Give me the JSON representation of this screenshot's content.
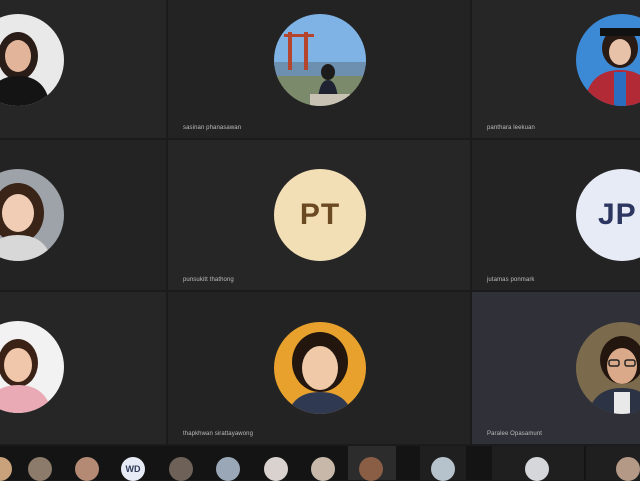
{
  "participants": [
    {
      "name": ""
    },
    {
      "name": "sasinan phanasawan"
    },
    {
      "name": "panthara leekuan"
    },
    {
      "name": ""
    },
    {
      "name": "punsukitt thathong",
      "initials": "PT"
    },
    {
      "name": "jutamas ponmark",
      "initials": "JP"
    },
    {
      "name": ""
    },
    {
      "name": "thapkhwan sirattayawong"
    },
    {
      "name": "Paralee Opasamunt"
    }
  ],
  "strip": {
    "initials_tile": "WD"
  },
  "colors": {
    "pt_avatar_bg": "#f3dfb6",
    "pt_avatar_text": "#6b4a22",
    "jp_avatar_bg": "#e7ebf6",
    "jp_avatar_text": "#2c3660",
    "active_tile_bg": "#2f3038"
  }
}
